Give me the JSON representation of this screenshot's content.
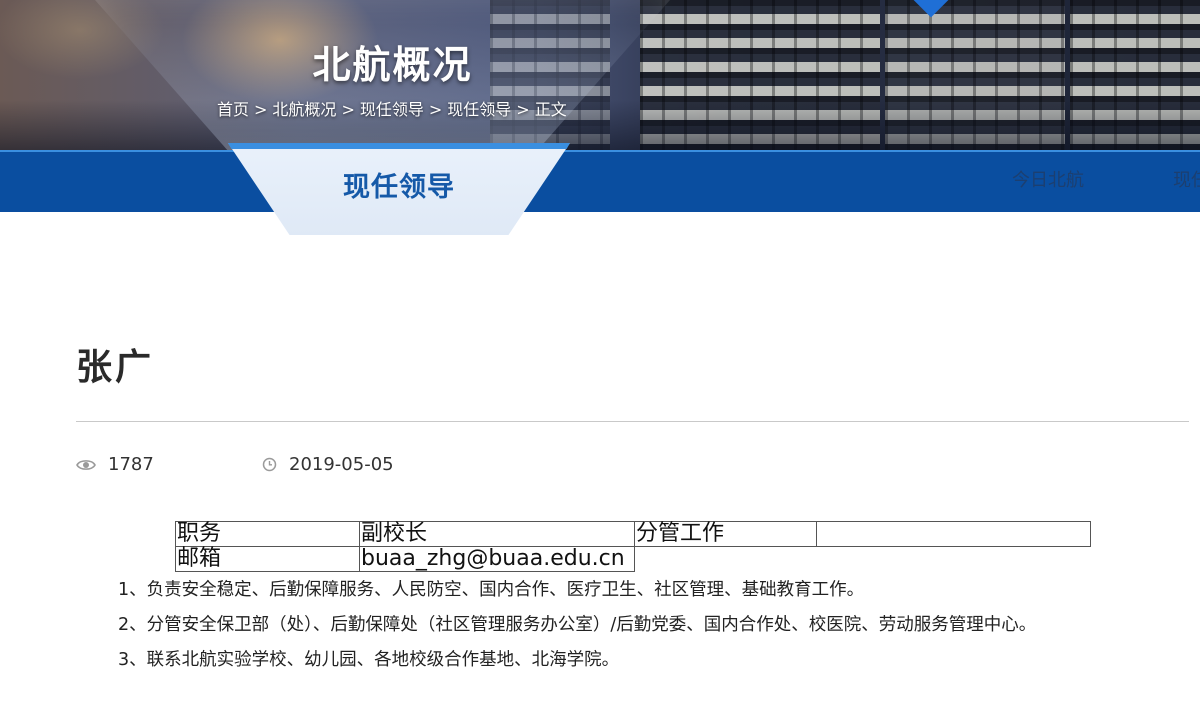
{
  "header": {
    "section_title": "北航概况",
    "breadcrumb": [
      "首页",
      "北航概况",
      "现任领导",
      "现任领导",
      "正文"
    ],
    "breadcrumb_sep": ">"
  },
  "nav": {
    "active_tab": "现任领导",
    "links": [
      "今日北航",
      "现任"
    ]
  },
  "article": {
    "title": "张广",
    "views": "1787",
    "date": "2019-05-05",
    "table": {
      "rows": [
        [
          "职务",
          "副校长",
          "分管工作",
          ""
        ],
        [
          "邮箱",
          "buaa_zhg@buaa.edu.cn"
        ]
      ]
    },
    "duties": [
      "1、负责安全稳定、后勤保障服务、人民防空、国内合作、医疗卫生、社区管理、基础教育工作。",
      "2、分管安全保卫部（处）、后勤保障处（社区管理服务办公室）/后勤党委、国内合作处、校医院、劳动服务管理中心。",
      "3、联系北航实验学校、幼儿园、各地校级合作基地、北海学院。"
    ]
  },
  "icons": {
    "views": "eye-icon",
    "date": "clock-icon"
  },
  "colors": {
    "nav_bar": "#0a4ea0",
    "tab_text": "#1559a8",
    "tab_bg": "#e3ecf8"
  }
}
